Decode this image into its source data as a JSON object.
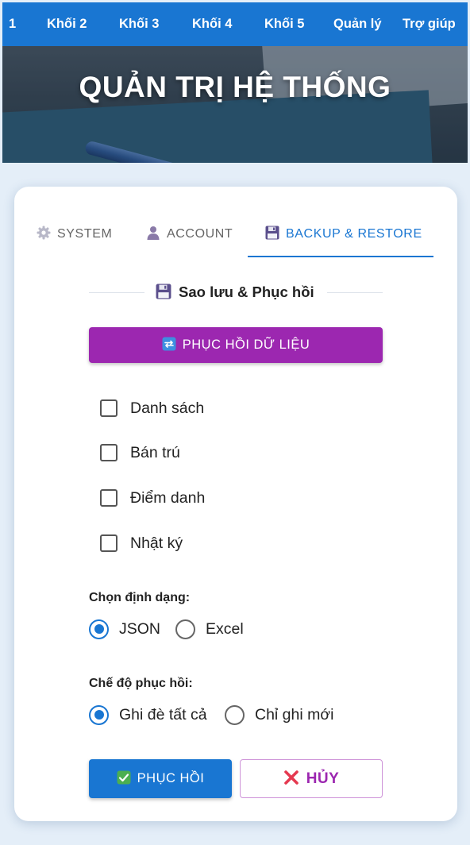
{
  "nav": {
    "items": [
      {
        "label": "1"
      },
      {
        "label": "Khối 2"
      },
      {
        "label": "Khối 3"
      },
      {
        "label": "Khối 4"
      },
      {
        "label": "Khối 5"
      },
      {
        "label": "Quản lý"
      },
      {
        "label": "Trợ giúp"
      }
    ]
  },
  "banner": {
    "title": "QUẢN TRỊ HỆ THỐNG"
  },
  "tabs": [
    {
      "label": "SYSTEM",
      "icon": "gear-icon",
      "active": false
    },
    {
      "label": "ACCOUNT",
      "icon": "person-icon",
      "active": false
    },
    {
      "label": "BACKUP & RESTORE",
      "icon": "floppy-disk-icon",
      "active": true
    }
  ],
  "section": {
    "title": "Sao lưu & Phục hồi",
    "icon": "floppy-disk-icon"
  },
  "restore_data_button": {
    "label": "PHỤC HỒI DỮ LIỆU",
    "icon": "refresh-arrows-icon"
  },
  "checkboxes": [
    {
      "label": "Danh sách",
      "checked": false
    },
    {
      "label": "Bán trú",
      "checked": false
    },
    {
      "label": "Điểm danh",
      "checked": false
    },
    {
      "label": "Nhật ký",
      "checked": false
    }
  ],
  "format": {
    "label": "Chọn định dạng:",
    "options": [
      {
        "label": "JSON",
        "selected": true
      },
      {
        "label": "Excel",
        "selected": false
      }
    ]
  },
  "mode": {
    "label": "Chế độ phục hồi:",
    "options": [
      {
        "label": "Ghi đè tất cả",
        "selected": true
      },
      {
        "label": "Chỉ ghi mới",
        "selected": false
      }
    ]
  },
  "actions": {
    "restore_label": "PHỤC HỒI",
    "restore_icon": "check-mark-icon",
    "cancel_label": "HỦY",
    "cancel_icon": "cross-mark-icon"
  },
  "colors": {
    "primary": "#1976d2",
    "accent_purple": "#9c27b0",
    "background": "#e4eef8"
  }
}
